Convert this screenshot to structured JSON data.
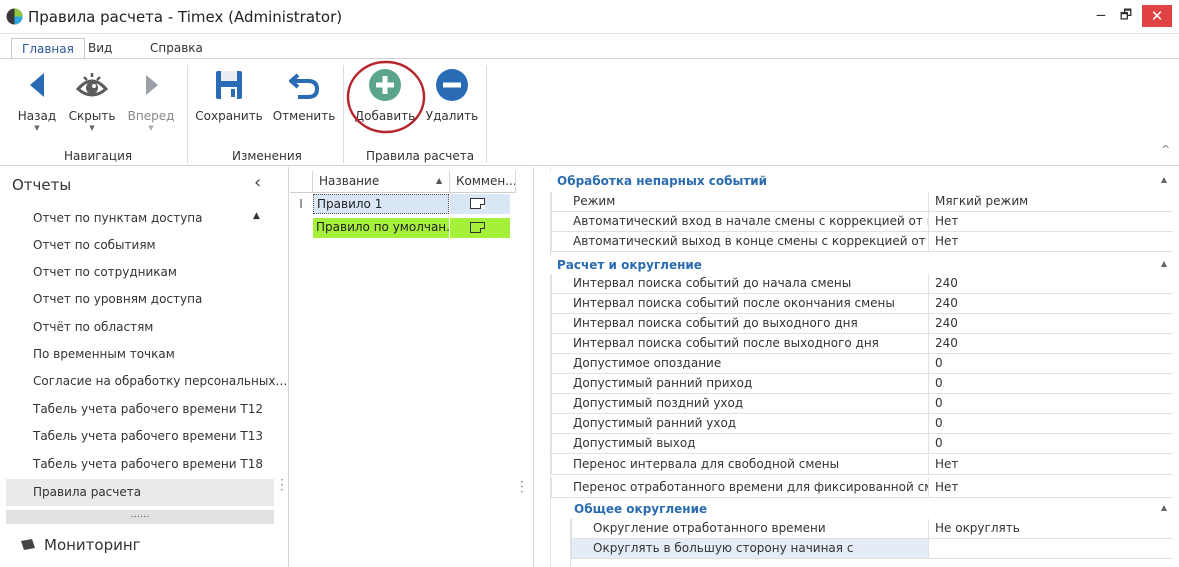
{
  "window": {
    "title": "Правила расчета - Timex (Administrator)",
    "colors": {
      "close": "#e04343",
      "category_text": "#2b6cb0",
      "selected_row": "#a9d18e",
      "default_row": "#a5f03b",
      "focus_row": "#d8e6f5"
    }
  },
  "ribbon": {
    "tabs": [
      "Главная",
      "Вид",
      "Справка"
    ],
    "active_tab": "Главная",
    "buttons": {
      "back": "Назад",
      "hide": "Скрыть",
      "forward": "Вперед",
      "save": "Сохранить",
      "undo": "Отменить",
      "add": "Добавить",
      "delete": "Удалить"
    },
    "groups": {
      "navigation": "Навигация",
      "changes": "Изменения",
      "rules": "Правила расчета"
    },
    "icons": [
      "back-arrow-icon",
      "eye-icon",
      "forward-arrow-icon",
      "save-disk-icon",
      "undo-icon",
      "add-plus-icon",
      "delete-minus-icon"
    ]
  },
  "reports_panel": {
    "header": "Отчеты",
    "items": [
      "Отчет по пунктам доступа",
      "Отчет по событиям",
      "Отчет по сотрудникам",
      "Отчет по уровням доступа",
      "Отчёт по областям",
      "По временным точкам",
      "Согласие на обработку персональных…",
      "Табель учета рабочего времени Т12",
      "Табель учета рабочего времени Т13",
      "Табель учета рабочего времени Т18",
      "Правила расчета"
    ],
    "selected_item": "Правила расчета",
    "dots": "......",
    "monitoring": "Мониторинг"
  },
  "rules_grid": {
    "columns": [
      "Название",
      "Коммен..."
    ],
    "rows": [
      {
        "name": "Правило 1",
        "indicator": "I"
      },
      {
        "name": "Правило по умолчан...",
        "indicator": ""
      }
    ]
  },
  "properties": {
    "cat1": {
      "label": "Обработка непарных событий",
      "rows": [
        {
          "name": "Режим",
          "value": "Мягкий режим"
        },
        {
          "name": "Автоматический вход в начале смены с коррекцией от на...",
          "value": "Нет"
        },
        {
          "name": "Автоматический выход в конце смены с коррекцией от ко...",
          "value": "Нет"
        }
      ]
    },
    "cat2": {
      "label": "Расчет и округление",
      "rows": [
        {
          "name": "Интервал поиска событий до начала смены",
          "value": "240"
        },
        {
          "name": "Интервал поиска событий после окончания смены",
          "value": "240"
        },
        {
          "name": "Интервал поиска событий до выходного дня",
          "value": "240"
        },
        {
          "name": "Интервал поиска событий после выходного дня",
          "value": "240"
        },
        {
          "name": "Допустимое опоздание",
          "value": "0"
        },
        {
          "name": "Допустимый ранний приход",
          "value": "0"
        },
        {
          "name": "Допустимый поздний уход",
          "value": "0"
        },
        {
          "name": "Допустимый ранний уход",
          "value": "0"
        },
        {
          "name": "Допустимый выход",
          "value": "0"
        },
        {
          "name": "Перенос интервала для свободной смены",
          "value": "Нет"
        },
        {
          "name": "Перенос отработанного времени для фиксированной смены",
          "value": "Нет"
        }
      ]
    },
    "cat3": {
      "label": "Общее округление",
      "rows": [
        {
          "name": "Округление отработанного времени",
          "value": "Не округлять"
        },
        {
          "name": "Округлять в большую сторону начиная с",
          "value": ""
        }
      ]
    }
  }
}
